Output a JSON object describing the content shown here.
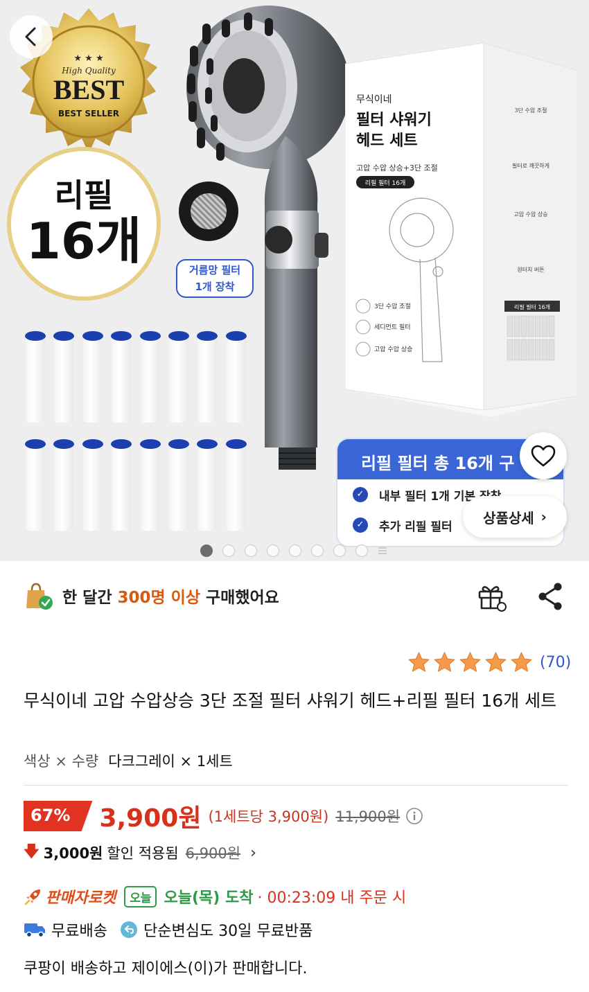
{
  "hero": {
    "badge": {
      "top": "High Quality",
      "big": "BEST",
      "bottom": "BEST SELLER"
    },
    "refill": {
      "line1": "리필",
      "line2": "16개"
    },
    "mesh_label": [
      "거름망 필터",
      "1개 장착"
    ],
    "box": {
      "brand": "무식이네",
      "title_1": "필터 샤워기",
      "title_2": "헤드 세트",
      "subtitle": "고압 수압 상승+3단 조절",
      "tag": "리필 필터 16개"
    },
    "promo": {
      "header": "리필 필터 총 16개 구",
      "rows": [
        "내부 필터 1개 기본 장착",
        "추가 리필 필터"
      ]
    },
    "detail_button": "상품상세",
    "dots_count": 8,
    "active_dot": 0
  },
  "buyers": {
    "prefix": "한 달간 ",
    "highlight": "300명 이상",
    "suffix": " 구매했어요"
  },
  "rating": {
    "stars": 5,
    "count": "(70)"
  },
  "product": {
    "title": "무식이네 고압 수압상승 3단 조절 필터 샤워기 헤드+리필 필터 16개 세트",
    "option_label": "색상 × 수량",
    "option_value": "다크그레이 × 1세트"
  },
  "price": {
    "discount_rate": "67%",
    "sale_price": "3,900원",
    "per_unit": "(1세트당 3,900원)",
    "original": "11,900원"
  },
  "coupon": {
    "amount": "3,000원",
    "text": "할인 적용됨",
    "before": "6,900원"
  },
  "delivery": {
    "badge": "판매자로켓",
    "today_tag": "오늘",
    "arrival": "오늘(목) 도착",
    "cutoff": "· 00:23:09 내 주문 시",
    "free_shipping": "무료배송",
    "returns": "단순변심도 30일 무료반품"
  },
  "seller_note": "쿠팡이 배송하고 제이에스(이)가 판매합니다.",
  "colors": {
    "accent_red": "#d7311b",
    "rocket_orange": "#e04b1a",
    "today_green": "#2e9a48",
    "link_blue": "#2f57c9",
    "star_orange": "#f59a4a"
  }
}
